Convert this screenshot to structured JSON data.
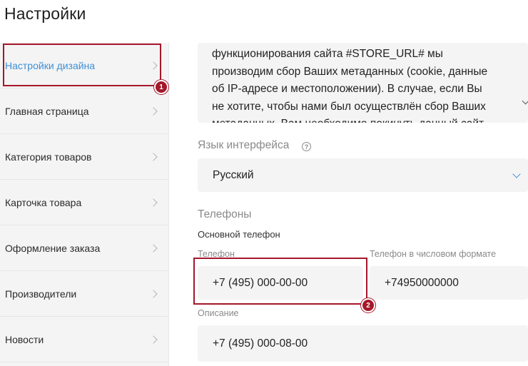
{
  "page": {
    "title": "Настройки"
  },
  "sidebar": {
    "items": [
      {
        "label": "Настройки дизайна",
        "active": true
      },
      {
        "label": "Главная страница"
      },
      {
        "label": "Категория товаров"
      },
      {
        "label": "Карточка товара"
      },
      {
        "label": "Оформление заказа"
      },
      {
        "label": "Производители"
      },
      {
        "label": "Новости"
      }
    ]
  },
  "cookie_text": {
    "lines": [
      "функционирования сайта #STORE_URL# мы",
      "производим сбор Ваших метаданных (cookie, данные",
      "об IP-адресе и местоположении). В случае, если Вы",
      "не хотите, чтобы нами был осуществлён сбор Ваших",
      "метаданных. Вам необходимо покинуть данный сайт"
    ]
  },
  "language": {
    "label": "Язык интерфейса",
    "help_icon": "question-icon",
    "value": "Русский"
  },
  "phones": {
    "section_title": "Телефоны",
    "main_phone_title": "Основной телефон",
    "phone_label": "Телефон",
    "phone_value": "+7 (495) 000-00-00",
    "numeric_label": "Телефон в числовом формате",
    "numeric_value": "+74950000000",
    "description_label": "Описание",
    "description_value": "+7 (495) 000-08-00"
  },
  "callouts": [
    {
      "number": "1"
    },
    {
      "number": "2"
    }
  ],
  "colors": {
    "accent": "#3d8fd6",
    "callout": "#a5172a",
    "field_bg": "#f4f4f4"
  }
}
